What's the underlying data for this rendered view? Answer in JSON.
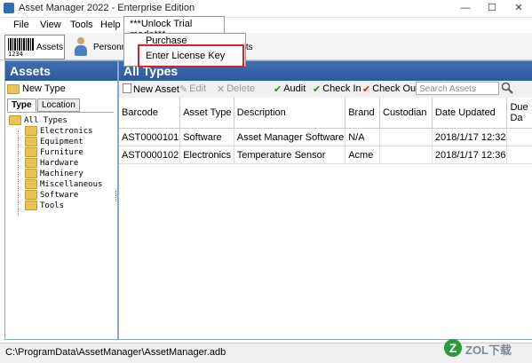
{
  "window": {
    "title": "Asset Manager 2022 - Enterprise Edition",
    "minimize": "—",
    "maximize": "☐",
    "close": "✕"
  },
  "menu": {
    "file": "File",
    "view": "View",
    "tools": "Tools",
    "help": "Help",
    "unlock": "***Unlock Trial mode***"
  },
  "dropdown": {
    "purchase": "Purchase",
    "enter_license": "Enter License Key"
  },
  "toolbar": {
    "assets": "Assets",
    "personnel": "Personne",
    "reports": "orts",
    "barcode_digits": "1234"
  },
  "left": {
    "title": "Assets",
    "new_type": "New Type",
    "tabs": [
      "Type",
      "Location"
    ],
    "tree_root": "All Types",
    "tree_items": [
      "Electronics",
      "Equipment",
      "Furniture",
      "Hardware",
      "Machinery",
      "Miscellaneous",
      "Software",
      "Tools"
    ]
  },
  "main": {
    "title": "All Types",
    "actions": {
      "new_asset": "New Asset",
      "edit": "Edit",
      "delete": "Delete",
      "audit": "Audit",
      "check_in": "Check In",
      "check_out": "Check Out"
    },
    "search_placeholder": "Search Assets",
    "columns": [
      "Barcode",
      "Asset Type",
      "Description",
      "Brand",
      "Custodian",
      "Date Updated",
      "Due Da"
    ],
    "rows": [
      [
        "AST0000101",
        "Software",
        "Asset Manager Software",
        "N/A",
        "",
        "2018/1/17 12:32",
        ""
      ],
      [
        "AST0000102",
        "Electronics",
        "Temperature Sensor",
        "Acme",
        "",
        "2018/1/17 12:36",
        ""
      ]
    ]
  },
  "status": {
    "path": "C:\\ProgramData\\AssetManager\\AssetManager.adb"
  },
  "watermark": {
    "letter": "Z",
    "text": "ZOL下载"
  },
  "colors": {
    "header_blue": "#2b5aa0",
    "highlight_red": "#d9202a"
  }
}
